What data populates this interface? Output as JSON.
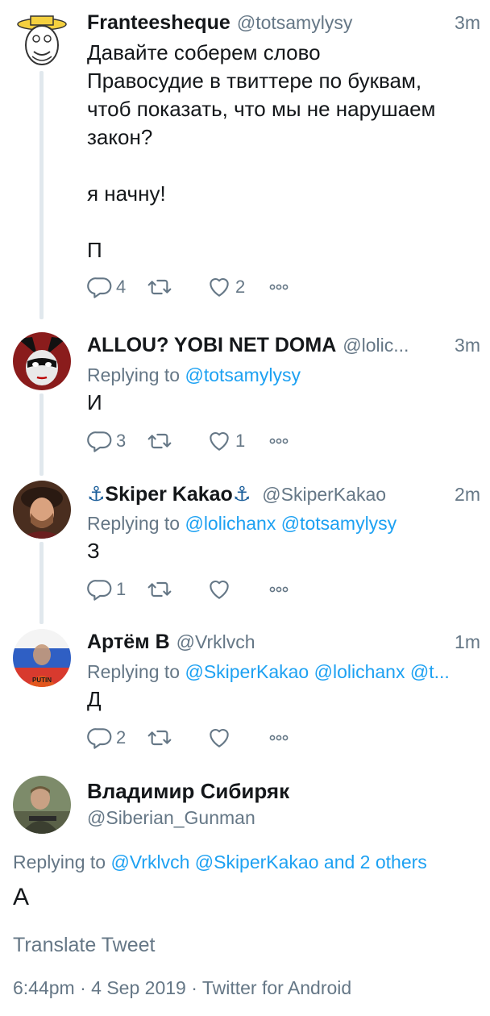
{
  "tweets": [
    {
      "name": "Franteesheque",
      "handle": "@totsamylysy",
      "time": "3m",
      "text": "Давайте соберем слово\nПравосудие в твиттере по буквам,\nчтоб показать, что мы не нарушаем\nзакон?\n\nя начну!\n\nП",
      "replies": "4",
      "retweets": "",
      "likes": "2"
    },
    {
      "name": "ALLOU? YOBI NET DOMA",
      "handle": "@lolic...",
      "time": "3m",
      "replying_prefix": "Replying to",
      "replying_to": "@totsamylysy",
      "text": "И",
      "replies": "3",
      "retweets": "",
      "likes": "1"
    },
    {
      "name_prefix": "⚓",
      "name": "Skiper Kakao",
      "name_suffix": "⚓",
      "handle": "@SkiperKakao",
      "time": "2m",
      "replying_prefix": "Replying to",
      "replying_to": "@lolichanx @totsamylysy",
      "text": "З",
      "replies": "1",
      "retweets": "",
      "likes": ""
    },
    {
      "name": "Артём В",
      "handle": "@Vrklvch",
      "time": "1m",
      "replying_prefix": "Replying to",
      "replying_to": "@SkiperKakao @lolichanx @t...",
      "text": "Д",
      "replies": "2",
      "retweets": "",
      "likes": ""
    }
  ],
  "focused": {
    "name": "Владимир Сибиряк",
    "handle": "@Siberian_Gunman",
    "replying_prefix": "Replying to",
    "replying_to": "@Vrklvch @SkiperKakao and 2 others",
    "text": "А",
    "translate": "Translate Tweet",
    "meta": "6:44pm · 4 Sep 2019 · Twitter for Android"
  },
  "avatar_texts": {
    "putin_shirt": "PUTIN"
  },
  "colors": {
    "link": "#1da1f2",
    "secondary": "#657786",
    "primary": "#14171a",
    "thread_line": "#e1e8ed"
  },
  "icons": [
    "reply-icon",
    "retweet-icon",
    "like-icon",
    "more-icon"
  ]
}
